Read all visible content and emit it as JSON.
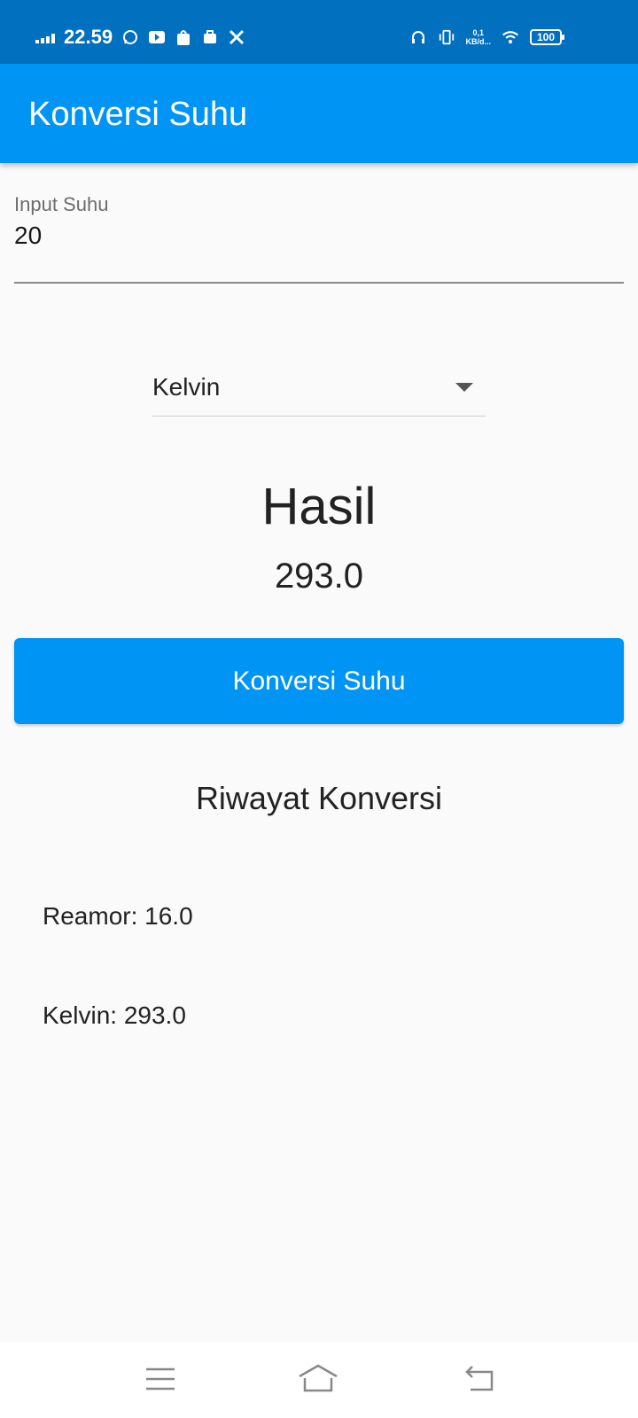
{
  "status_bar": {
    "time": "22.59",
    "net_speed_top": "0,1",
    "net_speed_bottom": "KB/d...",
    "battery": "100",
    "icons": [
      "signal-icon",
      "whatsapp-icon",
      "youtube-icon",
      "shopee-icon",
      "shop-icon",
      "tools-icon",
      "headphones-icon",
      "vibrate-icon",
      "wifi-icon",
      "battery-icon"
    ]
  },
  "app_bar": {
    "title": "Konversi Suhu"
  },
  "input": {
    "label": "Input Suhu",
    "value": "20"
  },
  "dropdown": {
    "selected": "Kelvin"
  },
  "result": {
    "title": "Hasil",
    "value": "293.0"
  },
  "button": {
    "label": "Konversi Suhu"
  },
  "history": {
    "title": "Riwayat Konversi",
    "items": [
      "Reamor: 16.0",
      "Kelvin: 293.0"
    ]
  },
  "colors": {
    "status_bar": "#0070bf",
    "primary": "#0094f5",
    "background": "#fafafa"
  }
}
